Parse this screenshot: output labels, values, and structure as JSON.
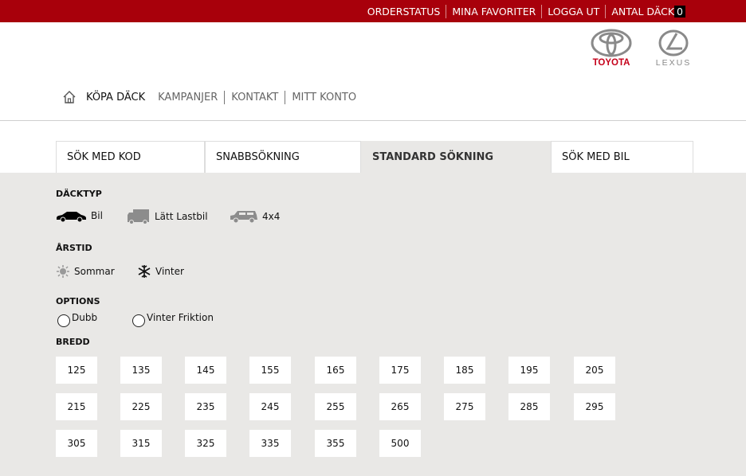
{
  "topnav": {
    "items": [
      "ORDERSTATUS",
      "MINA FAVORITER",
      "LOGGA UT",
      "ANTAL DÄCK"
    ],
    "count": "0"
  },
  "brands": {
    "toyota": "TOYOTA",
    "lexus": "LEXUS"
  },
  "mainnav": {
    "items": [
      "KÖPA DÄCK",
      "KAMPANJER",
      "KONTAKT",
      "MITT KONTO"
    ]
  },
  "tabs": [
    "SÖK MED KOD",
    "SNABBSÖKNING",
    "STANDARD SÖKNING",
    "SÖK MED BIL"
  ],
  "active_tab": "STANDARD SÖKNING",
  "dacktyp": {
    "title": "DÄCKTYP",
    "options": [
      "Bil",
      "Lätt Lastbil",
      "4x4"
    ]
  },
  "arstid": {
    "title": "ÅRSTID",
    "options": [
      "Sommar",
      "Vinter"
    ]
  },
  "options": {
    "title": "OPTIONS",
    "items": [
      "Dubb",
      "Vinter Friktion"
    ]
  },
  "bredd": {
    "title": "BREDD",
    "values": [
      "125",
      "135",
      "145",
      "155",
      "165",
      "175",
      "185",
      "195",
      "205",
      "215",
      "225",
      "235",
      "245",
      "255",
      "265",
      "275",
      "285",
      "295",
      "305",
      "315",
      "325",
      "335",
      "355",
      "500"
    ]
  },
  "colors": {
    "brand_red": "#a8000b",
    "panel": "#e9e8e6",
    "toyota_red": "#c5001a"
  }
}
